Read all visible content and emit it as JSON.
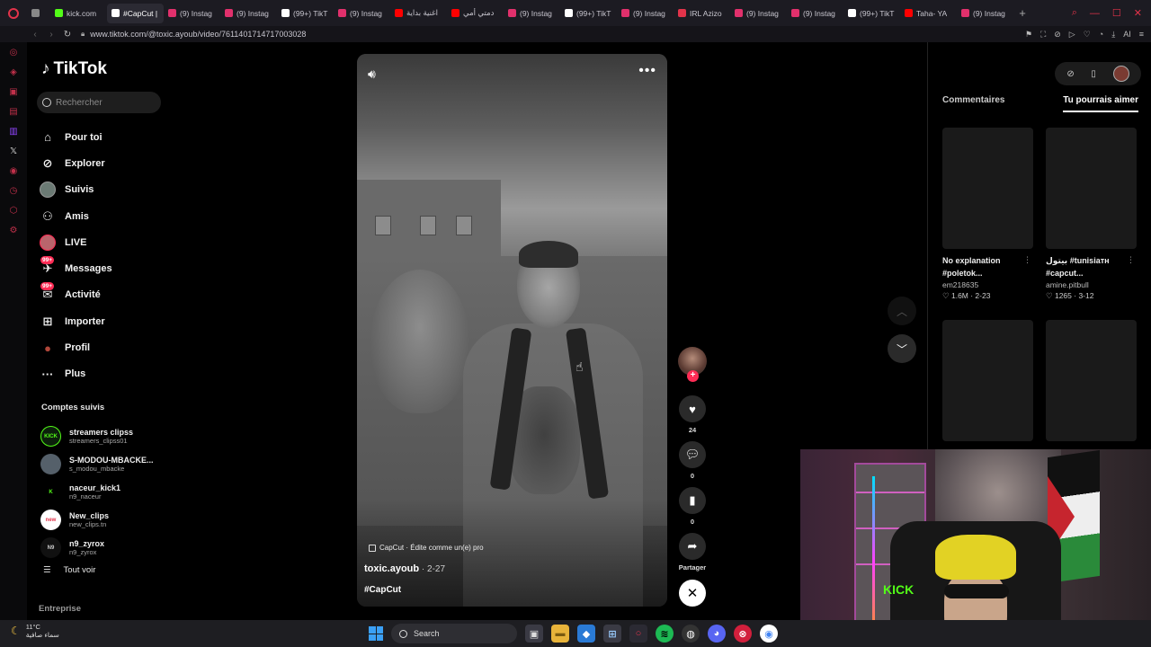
{
  "browser": {
    "tabs": [
      {
        "label": "",
        "color": "#888888",
        "icon": "grid-icon"
      },
      {
        "label": "kick.com",
        "color": "#53fc18",
        "icon": "kick-icon"
      },
      {
        "label": "#CapCut | Tik",
        "color": "#ffffff",
        "icon": "tiktok-icon",
        "active": true
      },
      {
        "label": "(9) Instag",
        "color": "#e1306c",
        "icon": "instagram-icon"
      },
      {
        "label": "(9) Instag",
        "color": "#e1306c",
        "icon": "instagram-icon"
      },
      {
        "label": "(99+) TikT",
        "color": "#ffffff",
        "icon": "tiktok-icon"
      },
      {
        "label": "(9) Instag",
        "color": "#e1306c",
        "icon": "instagram-icon"
      },
      {
        "label": "اغنية بداية",
        "color": "#ff0000",
        "icon": "youtube-icon"
      },
      {
        "label": "دمتي أمي",
        "color": "#ff0000",
        "icon": "youtube-icon"
      },
      {
        "label": "(9) Instag",
        "color": "#e1306c",
        "icon": "instagram-icon"
      },
      {
        "label": "(99+) TikT",
        "color": "#ffffff",
        "icon": "tiktok-icon"
      },
      {
        "label": "(9) Instag",
        "color": "#e1306c",
        "icon": "instagram-icon"
      },
      {
        "label": "IRL Azizo",
        "color": "#e2334a",
        "icon": "stream-icon"
      },
      {
        "label": "(9) Instag",
        "color": "#e1306c",
        "icon": "instagram-icon"
      },
      {
        "label": "(9) Instag",
        "color": "#e1306c",
        "icon": "instagram-icon"
      },
      {
        "label": "(99+) TikT",
        "color": "#ffffff",
        "icon": "tiktok-icon"
      },
      {
        "label": "Taha- YA",
        "color": "#ff0000",
        "icon": "youtube-icon"
      },
      {
        "label": "(9) Instag",
        "color": "#e1306c",
        "icon": "instagram-icon"
      }
    ],
    "url": "www.tiktok.com/@toxic.ayoub/video/7611401714717003028",
    "addr_ai_label": "AI"
  },
  "tiktok": {
    "logo": "TikTok",
    "search_placeholder": "Rechercher",
    "nav": [
      {
        "label": "Pour toi",
        "icon": "home-icon"
      },
      {
        "label": "Explorer",
        "icon": "compass-icon"
      },
      {
        "label": "Suivis",
        "icon": "avatar-icon"
      },
      {
        "label": "Amis",
        "icon": "friends-icon"
      },
      {
        "label": "LIVE",
        "icon": "live-icon"
      },
      {
        "label": "Messages",
        "icon": "messages-icon",
        "badge": "99+"
      },
      {
        "label": "Activité",
        "icon": "activity-icon",
        "badge": "99+"
      },
      {
        "label": "Importer",
        "icon": "upload-icon"
      },
      {
        "label": "Profil",
        "icon": "profile-icon"
      },
      {
        "label": "Plus",
        "icon": "more-icon"
      }
    ],
    "follows_title": "Comptes suivis",
    "follows": [
      {
        "name": "streamers clipss",
        "user": "streamers_clipss01",
        "av": "KICK",
        "bg": "#0c1f0c",
        "fg": "#53fc18"
      },
      {
        "name": "S-MODOU-MBACKE...",
        "user": "s_modou_mbacke",
        "av": "",
        "bg": "#55606a",
        "fg": "#ffffff"
      },
      {
        "name": "naceur_kick1",
        "user": "n9_naceur",
        "av": "K",
        "bg": "#000000",
        "fg": "#53fc18"
      },
      {
        "name": "New_clips",
        "user": "new_clips.tn",
        "av": "new",
        "bg": "#ffffff",
        "fg": "#e2334a"
      },
      {
        "name": "n9_zyrox",
        "user": "n9_zyrox",
        "av": "N9",
        "bg": "#111111",
        "fg": "#cccccc"
      }
    ],
    "see_all": "Tout voir",
    "entreprise": "Entreprise"
  },
  "video": {
    "capcut_tag": "CapCut · Édite comme un(e) pro",
    "author": "toxic.ayoub",
    "date": " · 2-27",
    "hashtag": "#CapCut",
    "likes": "24",
    "comments": "0",
    "saves": "0",
    "share_label": "Partager"
  },
  "right_panel": {
    "tab_comments": "Commentaires",
    "tab_suggest": "Tu pourrais aimer",
    "cards": [
      {
        "title": "No explanation #poletok...",
        "author": "em218635",
        "stats": "♡ 1.6M · 2-23"
      },
      {
        "title": "بيتول #tunisiaтн #capcut...",
        "author": "amine.pitbull",
        "stats": "♡ 1265 · 3-12"
      },
      {
        "title": "",
        "author": "",
        "stats": ""
      },
      {
        "title": "",
        "author": "",
        "stats": ""
      }
    ]
  },
  "taskbar": {
    "temp": "11°C",
    "weather": "سماء صافية",
    "search_label": "Search"
  }
}
